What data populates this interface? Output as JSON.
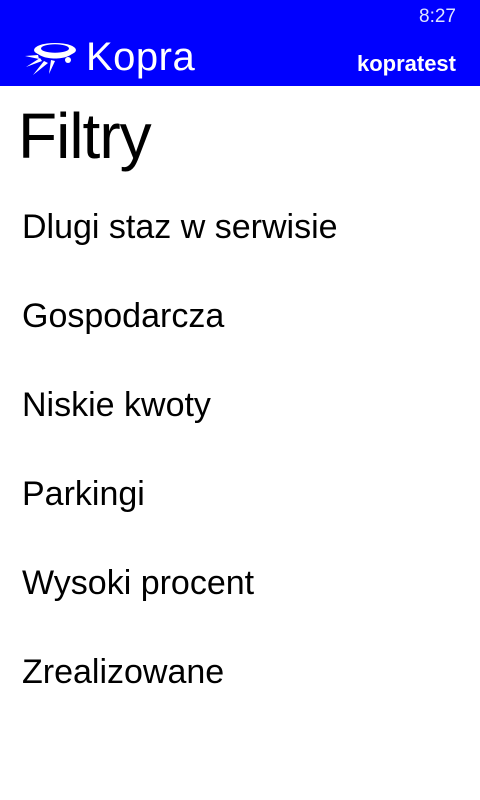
{
  "status_bar": {
    "time": "8:27"
  },
  "header": {
    "app_name": "Kopra",
    "username": "kopratest",
    "logo_icon": "kopra-ufo-logo"
  },
  "page": {
    "title": "Filtry"
  },
  "filters": [
    {
      "label": "Dlugi staz w serwisie"
    },
    {
      "label": "Gospodarcza"
    },
    {
      "label": "Niskie kwoty"
    },
    {
      "label": "Parkingi"
    },
    {
      "label": "Wysoki procent"
    },
    {
      "label": "Zrealizowane"
    }
  ],
  "colors": {
    "header_background": "#0000ff",
    "header_text": "#ffffff",
    "page_background": "#ffffff",
    "text": "#000000"
  }
}
